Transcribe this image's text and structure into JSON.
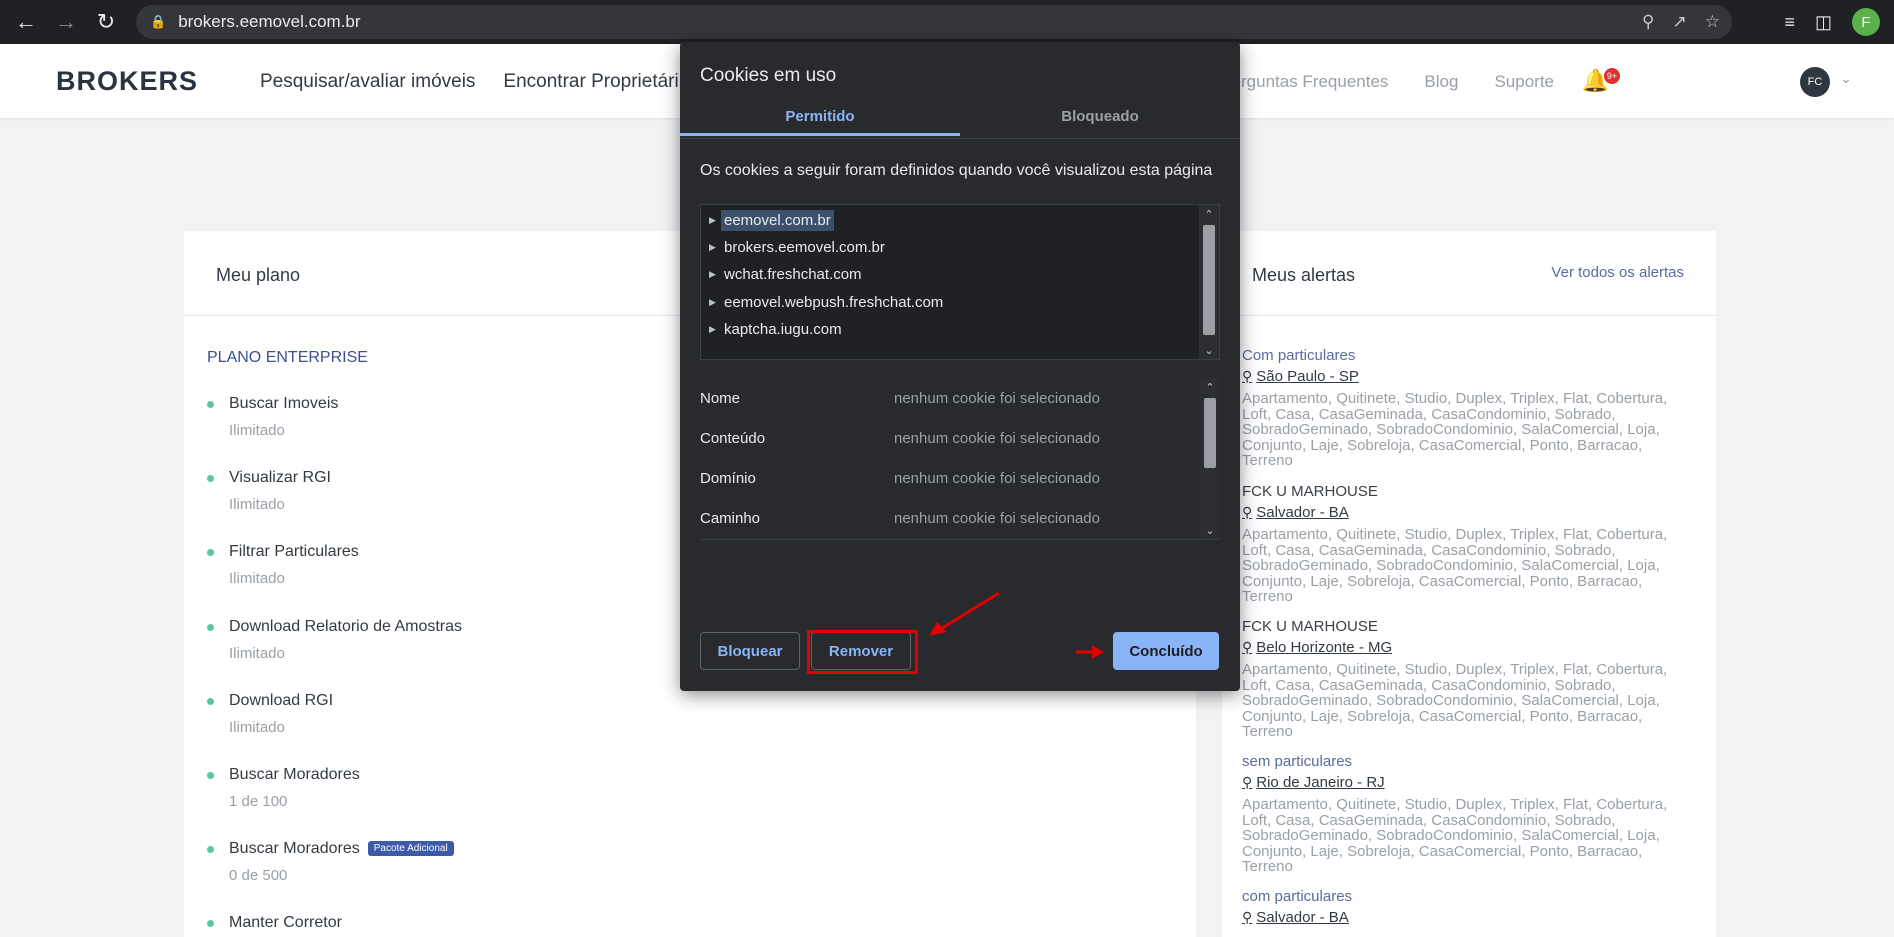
{
  "browser": {
    "url": "brokers.eemovel.com.br",
    "profile_initial": "F"
  },
  "header": {
    "logo": "BROKERS",
    "nav": [
      "Pesquisar/avaliar imóveis",
      "Encontrar Proprietári"
    ],
    "right_nav": [
      "Perguntas Frequentes",
      "Blog",
      "Suporte"
    ],
    "notification_badge": "9+",
    "user_initials": "FC"
  },
  "plan": {
    "title": "Meu plano",
    "plan_name": "PLANO ENTERPRISE",
    "features": [
      {
        "name": "Buscar Imoveis",
        "value": "Ilimitado"
      },
      {
        "name": "Visualizar RGI",
        "value": "Ilimitado"
      },
      {
        "name": "Filtrar Particulares",
        "value": "Ilimitado"
      },
      {
        "name": "Download Relatorio de Amostras",
        "value": "Ilimitado"
      },
      {
        "name": "Download RGI",
        "value": "Ilimitado"
      },
      {
        "name": "Buscar Moradores",
        "value": "1 de 100"
      },
      {
        "name": "Buscar Moradores",
        "value": "0 de 500",
        "badge": "Pacote Adicional"
      },
      {
        "name": "Manter Corretor",
        "value": ""
      }
    ]
  },
  "alerts": {
    "title": "Meus alertas",
    "see_all": "Ver todos os alertas",
    "types_text": "Apartamento, Quitinete, Studio, Duplex, Triplex, Flat, Cobertura, Loft, Casa, CasaGeminada, CasaCondominio, Sobrado, SobradoGeminado, SobradoCondominio, SalaComercial, Loja, Conjunto, Laje, Sobreloja, CasaComercial, Ponto, Barracao, Terreno",
    "items": [
      {
        "category": "Com particulares",
        "location": "São Paulo - SP"
      },
      {
        "category": "FCK U MARHOUSE",
        "location": "Salvador - BA"
      },
      {
        "category": "FCK U MARHOUSE",
        "location": "Belo Horizonte - MG"
      },
      {
        "category": "sem particulares",
        "location": "Rio de Janeiro - RJ"
      },
      {
        "category": "com particulares",
        "location": "Salvador - BA"
      }
    ]
  },
  "cookies_dialog": {
    "title": "Cookies em uso",
    "tab_allowed": "Permitido",
    "tab_blocked": "Bloqueado",
    "description": "Os cookies a seguir foram definidos quando você visualizou esta página",
    "domains": [
      "eemovel.com.br",
      "brokers.eemovel.com.br",
      "wchat.freshchat.com",
      "eemovel.webpush.freshchat.com",
      "kaptcha.iugu.com"
    ],
    "properties": [
      {
        "label": "Nome",
        "value": "nenhum cookie foi selecionado"
      },
      {
        "label": "Conteúdo",
        "value": "nenhum cookie foi selecionado"
      },
      {
        "label": "Domínio",
        "value": "nenhum cookie foi selecionado"
      },
      {
        "label": "Caminho",
        "value": "nenhum cookie foi selecionado"
      }
    ],
    "btn_block": "Bloquear",
    "btn_remove": "Remover",
    "btn_done": "Concluído"
  }
}
